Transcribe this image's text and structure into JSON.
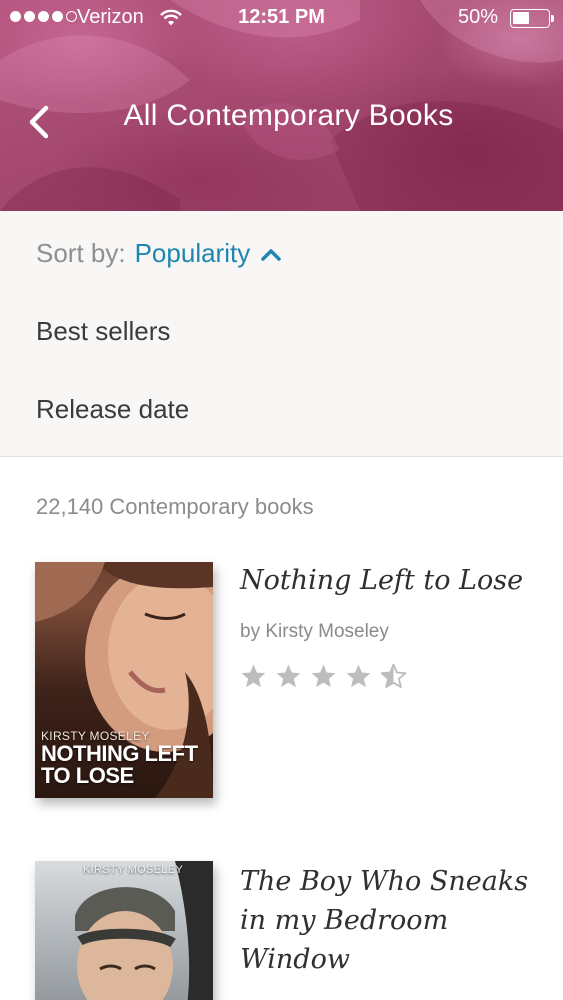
{
  "status_bar": {
    "carrier": "Verizon",
    "time": "12:51 PM",
    "battery_percent": "50%",
    "battery_level": 0.5,
    "signal_bars_filled": 4,
    "signal_bars_total": 5
  },
  "nav": {
    "title": "All Contemporary Books",
    "back_icon": "chevron-left-icon"
  },
  "sort": {
    "label": "Sort by:",
    "selected": "Popularity",
    "expanded_icon": "chevron-up-icon",
    "options": [
      "Best sellers",
      "Release date"
    ]
  },
  "results": {
    "count_text": "22,140 Contemporary books"
  },
  "books": [
    {
      "title": "Nothing Left to Lose",
      "author": "by Kirsty Moseley",
      "rating": 4.5,
      "rating_max": 5,
      "cover_author": "KIRSTY MOSELEY",
      "cover_title": "NOTHING LEFT TO LOSE"
    },
    {
      "title": "The Boy Who Sneaks in my Bedroom Window",
      "cover_author": "KIRSTY MOSELEY"
    }
  ],
  "colors": {
    "header": "#a4486f",
    "accent": "#1e86b0",
    "panel_bg": "#f8f7f5",
    "star": "#bdbdbd"
  }
}
